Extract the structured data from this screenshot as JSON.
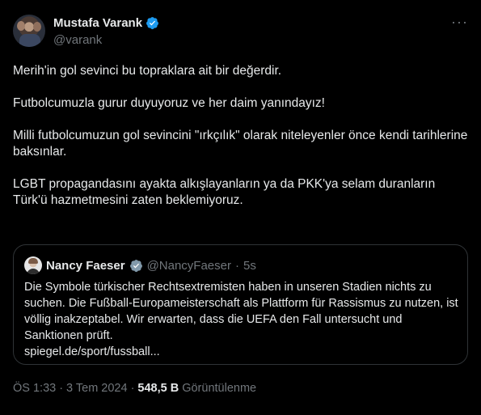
{
  "author": {
    "display_name": "Mustafa Varank",
    "handle": "@varank"
  },
  "more_icon": "more-horizontal-icon",
  "tweet": {
    "paragraphs": [
      "Merih'in gol sevinci bu topraklara ait bir değerdir.",
      "Futbolcumuzla gurur duyuyoruz ve her daim yanındayız!",
      "Milli futbolcumuzun gol sevincini \"ırkçılık\" olarak niteleyenler önce kendi tarihlerine baksınlar.",
      "LGBT propagandasını ayakta alkışlayanların ya da PKK'ya selam duranların Türk'ü hazmetmesini zaten beklemiyoruz."
    ]
  },
  "quote": {
    "display_name": "Nancy Faeser",
    "handle": "@NancyFaeser",
    "dot": "·",
    "time": "5s",
    "text": "Die Symbole türkischer Rechtsextremisten haben in unseren Stadien nichts zu suchen. Die Fußball-Europameisterschaft als Plattform für Rassismus zu nutzen, ist völlig inakzeptabel. Wir erwarten, dass die UEFA den Fall untersucht und Sanktionen prüft.",
    "link": "spiegel.de/sport/fussball..."
  },
  "meta": {
    "time": "ÖS 1:33",
    "dot1": "·",
    "date": "3 Tem 2024",
    "dot2": "·",
    "views_count": "548,5 B",
    "views_label": "Görüntülenme"
  },
  "colors": {
    "background": "#000000",
    "text": "#e7e9ea",
    "muted": "#71767b",
    "verified": "#1d9bf0",
    "border": "#2f3336"
  }
}
